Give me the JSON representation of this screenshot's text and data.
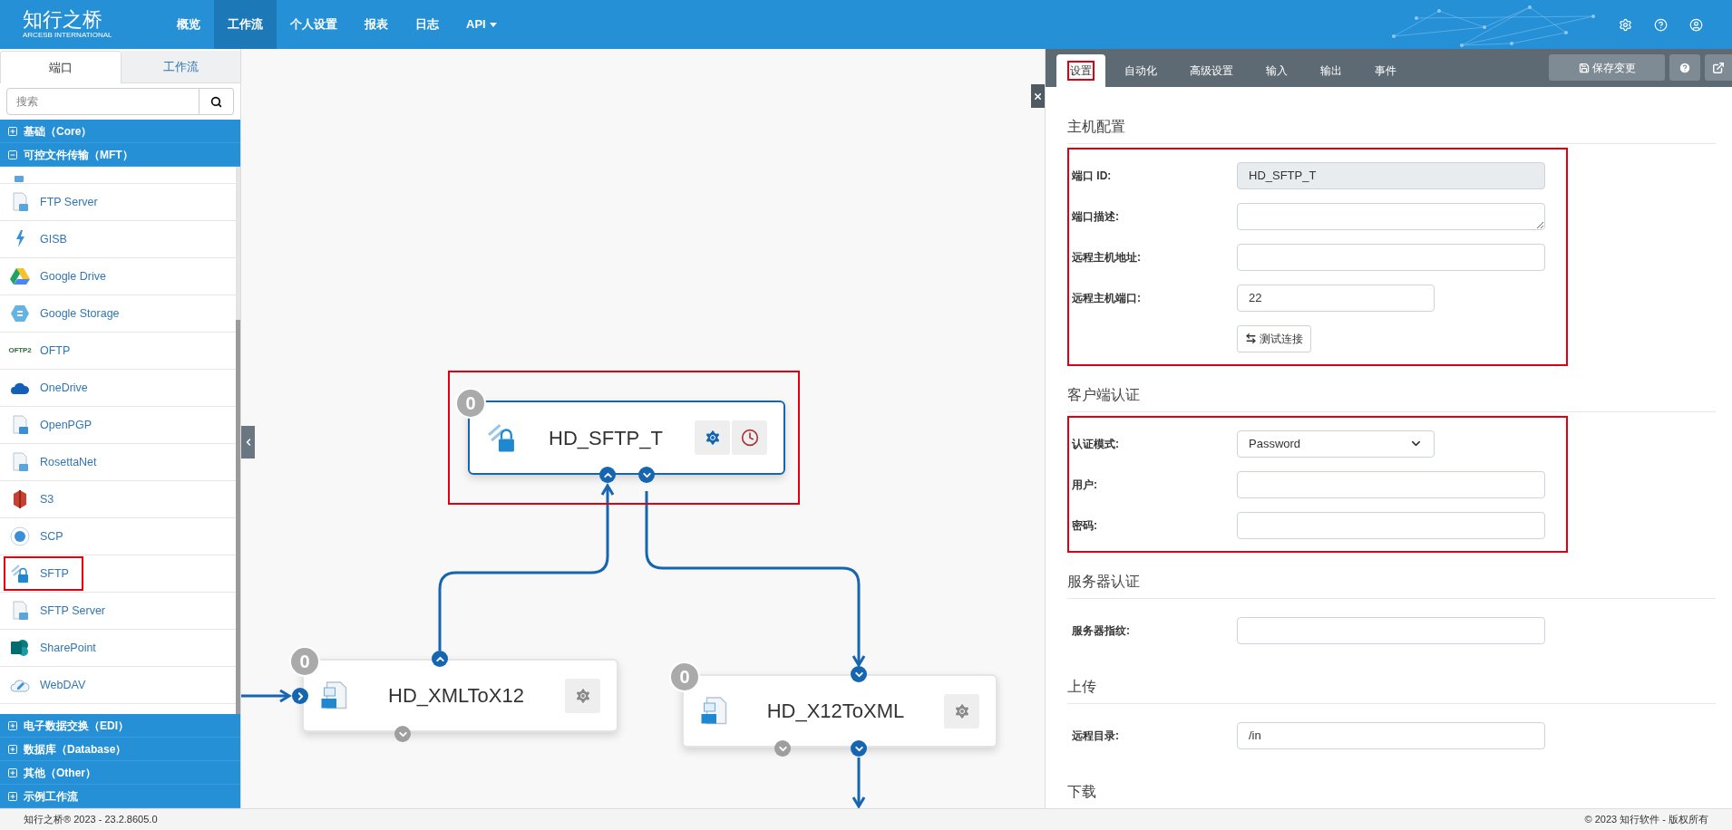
{
  "brand": {
    "name": "知行之桥",
    "tagline": "ARCESB INTERNATIONAL"
  },
  "nav": [
    {
      "label": "概览",
      "selected": false,
      "dropdown": false
    },
    {
      "label": "工作流",
      "selected": true,
      "dropdown": false
    },
    {
      "label": "个人设置",
      "selected": false,
      "dropdown": false
    },
    {
      "label": "报表",
      "selected": false,
      "dropdown": false
    },
    {
      "label": "日志",
      "selected": false,
      "dropdown": false
    },
    {
      "label": "API",
      "selected": false,
      "dropdown": true
    }
  ],
  "sidebar": {
    "tabs": [
      {
        "label": "端口",
        "selected": true
      },
      {
        "label": "工作流",
        "selected": false
      }
    ],
    "search": {
      "placeholder": "搜索"
    },
    "categories": [
      {
        "label": "基础（Core）",
        "expanded": false
      },
      {
        "label": "可控文件传输（MFT）",
        "expanded": true,
        "items": [
          {
            "label": "FTP Server",
            "highlighted": false
          },
          {
            "label": "GISB",
            "highlighted": false
          },
          {
            "label": "Google Drive",
            "highlighted": false
          },
          {
            "label": "Google Storage",
            "highlighted": false
          },
          {
            "label": "OFTP",
            "highlighted": false,
            "logo_text": "OFTP2"
          },
          {
            "label": "OneDrive",
            "highlighted": false
          },
          {
            "label": "OpenPGP",
            "highlighted": false
          },
          {
            "label": "RosettaNet",
            "highlighted": false
          },
          {
            "label": "S3",
            "highlighted": false
          },
          {
            "label": "SCP",
            "highlighted": false
          },
          {
            "label": "SFTP",
            "highlighted": true
          },
          {
            "label": "SFTP Server",
            "highlighted": false
          },
          {
            "label": "SharePoint",
            "highlighted": false
          },
          {
            "label": "WebDAV",
            "highlighted": false
          }
        ]
      },
      {
        "label": "电子数据交换（EDI）",
        "expanded": false
      },
      {
        "label": "数据库（Database）",
        "expanded": false
      },
      {
        "label": "其他（Other）",
        "expanded": false
      },
      {
        "label": "示例工作流",
        "expanded": false
      }
    ]
  },
  "canvas": {
    "nodes": [
      {
        "title": "HD_SFTP_T",
        "badge": "0",
        "selected": true,
        "highlighted": true,
        "actions": [
          {
            "kind": "settings"
          },
          {
            "kind": "schedule"
          }
        ],
        "ports": [
          {
            "kind": "up",
            "connected": true
          },
          {
            "kind": "down",
            "connected": true
          }
        ]
      },
      {
        "title": "HD_XMLToX12",
        "badge": "0",
        "selected": false,
        "highlighted": false,
        "actions": [
          {
            "kind": "settings"
          }
        ],
        "ports": [
          {
            "kind": "up",
            "connected": true
          },
          {
            "kind": "right",
            "connected": true
          },
          {
            "kind": "down",
            "connected": false
          }
        ]
      },
      {
        "title": "HD_X12ToXML",
        "badge": "0",
        "selected": false,
        "highlighted": false,
        "actions": [
          {
            "kind": "settings"
          }
        ],
        "ports": [
          {
            "kind": "down",
            "connected": true
          },
          {
            "kind": "down",
            "connected": false
          },
          {
            "kind": "down",
            "connected": true
          }
        ]
      }
    ]
  },
  "panel": {
    "tabs": [
      {
        "label": "设置",
        "selected": true,
        "highlighted": true
      },
      {
        "label": "自动化",
        "selected": false,
        "highlighted": false
      },
      {
        "label": "高级设置",
        "selected": false,
        "highlighted": false
      },
      {
        "label": "输入",
        "selected": false,
        "highlighted": false
      },
      {
        "label": "输出",
        "selected": false,
        "highlighted": false
      },
      {
        "label": "事件",
        "selected": false,
        "highlighted": false
      }
    ],
    "save_button": {
      "label": "保存变更",
      "disabled": true
    },
    "sections": [
      {
        "title": "主机配置",
        "highlighted": true,
        "fields": [
          {
            "kind": "readonly",
            "label": "端口 ID:",
            "value": "HD_SFTP_T"
          },
          {
            "kind": "textarea",
            "label": "端口描述:"
          },
          {
            "kind": "text",
            "label": "远程主机地址:"
          },
          {
            "kind": "number",
            "label": "远程主机端口:",
            "value": "22"
          },
          {
            "kind": "button",
            "label": "测试连接"
          }
        ]
      },
      {
        "title": "客户端认证",
        "highlighted": true,
        "fields": [
          {
            "kind": "select",
            "label": "认证模式:",
            "value": "Password"
          },
          {
            "kind": "text",
            "label": "用户:"
          },
          {
            "kind": "password",
            "label": "密码:"
          }
        ]
      },
      {
        "title": "服务器认证",
        "highlighted": false,
        "fields": [
          {
            "kind": "text",
            "label": "服务器指纹:"
          }
        ]
      },
      {
        "title": "上传",
        "highlighted": false,
        "fields": [
          {
            "kind": "text",
            "label": "远程目录:",
            "value": "/in"
          }
        ]
      },
      {
        "title": "下载",
        "highlighted": false
      }
    ]
  },
  "footer": {
    "left": "知行之桥® 2023 - 23.2.8605.0",
    "right": "© 2023 知行软件 - 版权所有"
  }
}
